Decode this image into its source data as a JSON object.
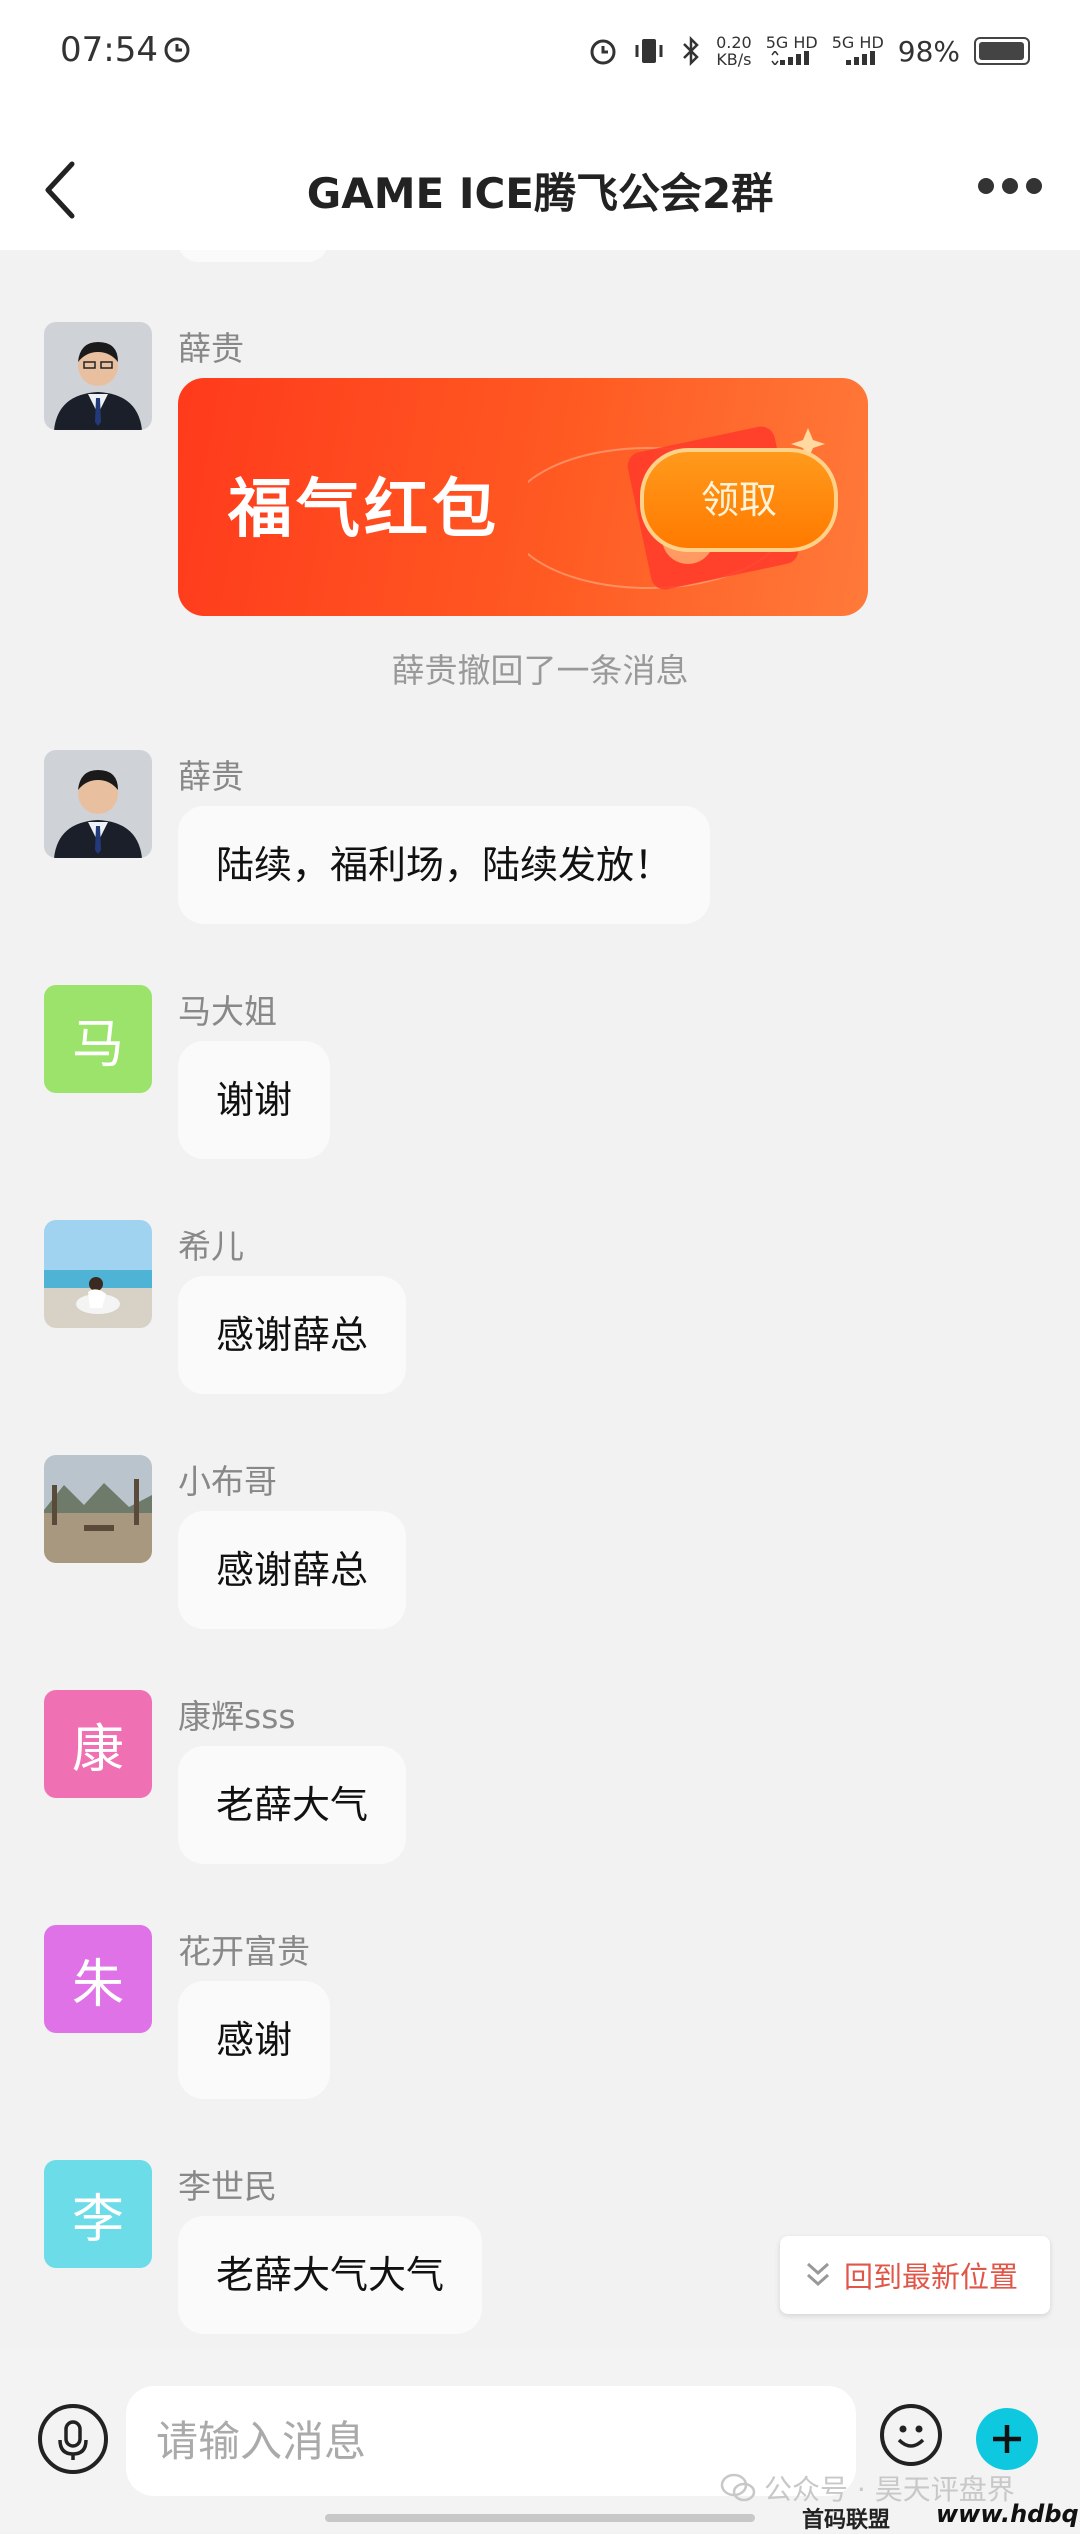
{
  "status_bar": {
    "time": "07:54",
    "net_speed_value": "0.20",
    "net_speed_unit": "KB/s",
    "sim1": "5G HD",
    "sim2": "5G HD",
    "battery": "98%"
  },
  "header": {
    "title": "GAME ICE腾飞公会2群"
  },
  "red_packet": {
    "sender": "薛贵",
    "title": "福气红包",
    "claim_label": "领取"
  },
  "system_note": "薛贵撤回了一条消息",
  "messages": [
    {
      "sender": "薛贵",
      "text": "陆续，福利场，陆续发放！"
    },
    {
      "sender": "马大姐",
      "avatar_char": "马",
      "avatar_color": "#9be36a",
      "text": "谢谢"
    },
    {
      "sender": "希儿",
      "text": "感谢薛总"
    },
    {
      "sender": "小布哥",
      "text": "感谢薛总"
    },
    {
      "sender": "康辉sss",
      "avatar_char": "康",
      "avatar_color": "#f071b3",
      "text": "老薛大气"
    },
    {
      "sender": "花开富贵",
      "avatar_char": "朱",
      "avatar_color": "#e072e8",
      "text": "感谢"
    },
    {
      "sender": "李世民",
      "avatar_char": "李",
      "avatar_color": "#6cdde8",
      "text": "老薛大气大气"
    }
  ],
  "jump_latest": {
    "label": "回到最新位置"
  },
  "input": {
    "placeholder": "请输入消息"
  },
  "watermark": {
    "line1": "公众号 · 昊天评盘界",
    "brand": "首码联盟",
    "url": "www.hdbq.cc"
  }
}
